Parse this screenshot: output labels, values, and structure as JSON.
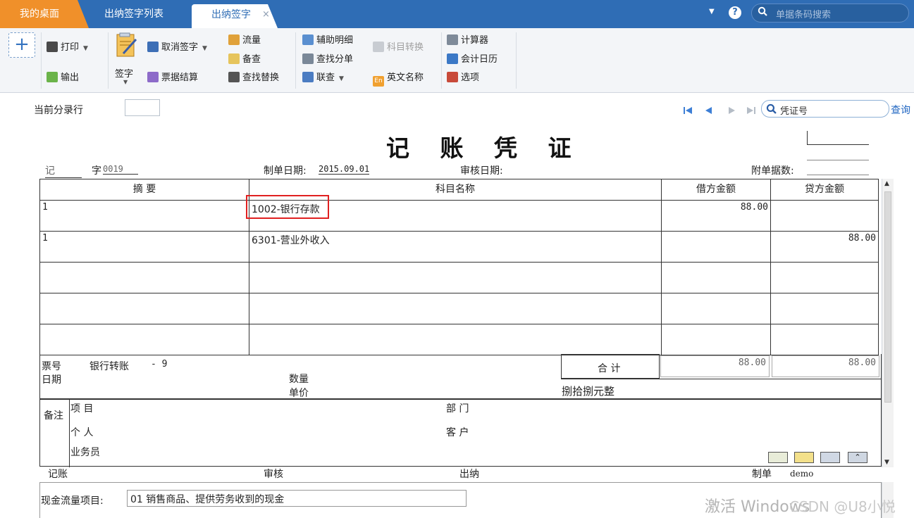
{
  "tabs": {
    "desk": "我的桌面",
    "sign_list": "出纳签字列表",
    "sign": "出纳签字",
    "close": "×"
  },
  "topbar": {
    "search_placeholder": "单据条码搜索",
    "help": "?"
  },
  "toolbar": {
    "add": "+",
    "print": "打印",
    "export": "输出",
    "sign": "签字",
    "cancel_sign": "取消签字",
    "bill_settle": "票据结算",
    "flow": "流量",
    "backup_check": "备查",
    "find_replace": "查找替换",
    "aux_detail": "辅助明细",
    "find_entry": "查找分单",
    "linked_query": "联查",
    "subject_convert": "科目转换",
    "english_name": "英文名称",
    "calculator": "计算器",
    "account_calendar": "会计日历",
    "options": "选项"
  },
  "current_line_label": "当前分录行",
  "query": {
    "placeholder": "凭证号",
    "button": "查询"
  },
  "voucher": {
    "title": "记 账 凭 证",
    "word": "记",
    "word_suffix": "字",
    "number": "0019",
    "make_date_label": "制单日期:",
    "make_date": "2015.09.01",
    "audit_date_label": "审核日期:",
    "attach_label": "附单据数:",
    "columns": [
      "摘 要",
      "科目名称",
      "借方金额",
      "贷方金额"
    ],
    "rows": [
      {
        "summary": "1",
        "account": "1002-银行存款",
        "debit": "88.00",
        "credit": ""
      },
      {
        "summary": "1",
        "account": "6301-营业外收入",
        "debit": "",
        "credit": "88.00"
      },
      {
        "summary": "",
        "account": "",
        "debit": "",
        "credit": ""
      },
      {
        "summary": "",
        "account": "",
        "debit": "",
        "credit": ""
      },
      {
        "summary": "",
        "account": "",
        "debit": "",
        "credit": ""
      }
    ],
    "ticket_label": "票号",
    "ticket_value": "银行转账",
    "ticket_no": "- 9",
    "date_label": "日期",
    "qty_label": "数量",
    "price_label": "单价",
    "total_label": "合 计",
    "total_debit": "88.00",
    "total_credit": "88.00",
    "amount_words": "捌拾捌元整",
    "remark_label": "备注",
    "project_label": "项 目",
    "person_label": "个 人",
    "salesman_label": "业务员",
    "dept_label": "部 门",
    "customer_label": "客 户",
    "bookkeeper_label": "记账",
    "auditor_label": "审核",
    "cashier_label": "出纳",
    "maker_label": "制单",
    "maker": "demo"
  },
  "cash_flow": {
    "label": "现金流量项目:",
    "value": "01 销售商品、提供劳务收到的现金"
  },
  "watermark": {
    "activate": "激活 Windows",
    "credit": "CSDN @U8小悦"
  },
  "colors": {
    "tabbar": "#2f6db5",
    "desk_tab": "#f0902a",
    "highlight": "#e02020",
    "link": "#2267c2"
  }
}
